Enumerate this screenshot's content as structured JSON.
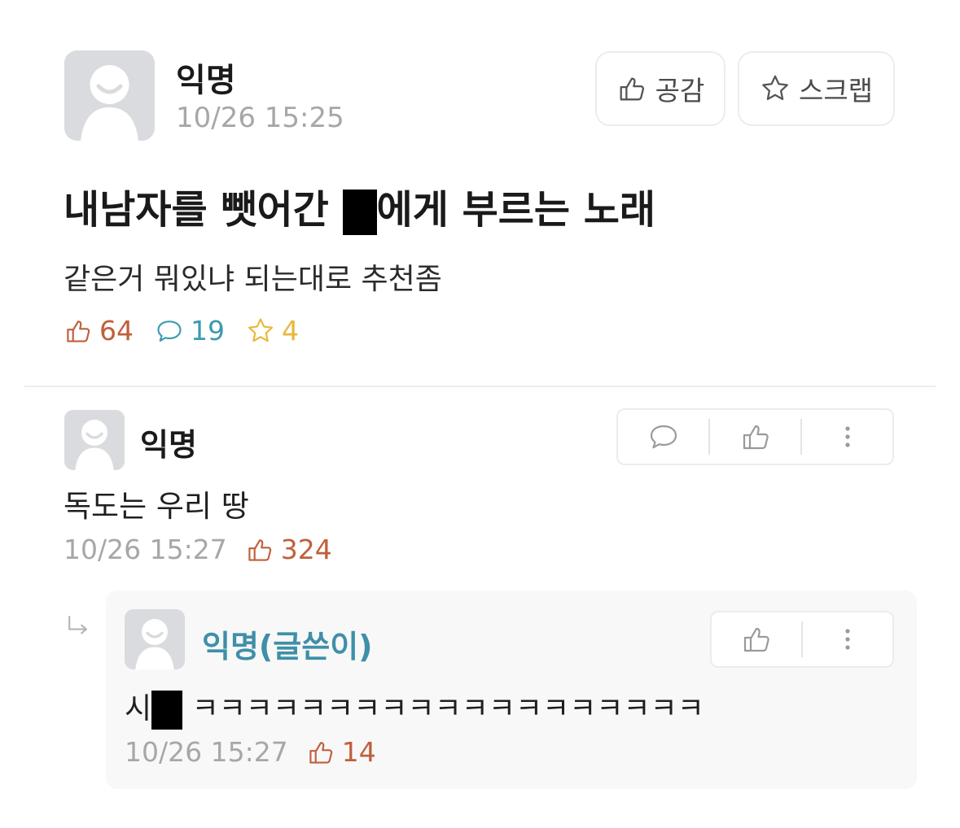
{
  "post": {
    "author": "익명",
    "time": "10/26 15:25",
    "like_button": "공감",
    "scrap_button": "스크랩",
    "title_before": "내남자를 뺏어간 ",
    "title_after": "에게 부르는 노래",
    "body": "같은거 뭐있냐 되는대로 추천좀",
    "stats": {
      "likes": "64",
      "comments": "19",
      "scraps": "4"
    }
  },
  "comments": [
    {
      "author": "익명",
      "text": "독도는 우리 땅",
      "time": "10/26 15:27",
      "likes": "324"
    }
  ],
  "reply": {
    "author": "익명(글쓴이)",
    "text_prefix": "시",
    "text_suffix": " ㅋㅋㅋㅋㅋㅋㅋㅋㅋㅋㅋㅋㅋㅋㅋㅋㅋㅋㅋ",
    "time": "10/26 15:27",
    "likes": "14"
  },
  "colors": {
    "like": "#c05f3c",
    "comment": "#3a9bb0",
    "scrap": "#e6b93a",
    "author_writer": "#3f8fa8",
    "meta_gray": "#a7a7a7"
  },
  "icons": [
    "avatar-icon",
    "thumbs-up-icon",
    "star-icon",
    "comment-icon",
    "more-icon",
    "reply-arrow-icon"
  ]
}
